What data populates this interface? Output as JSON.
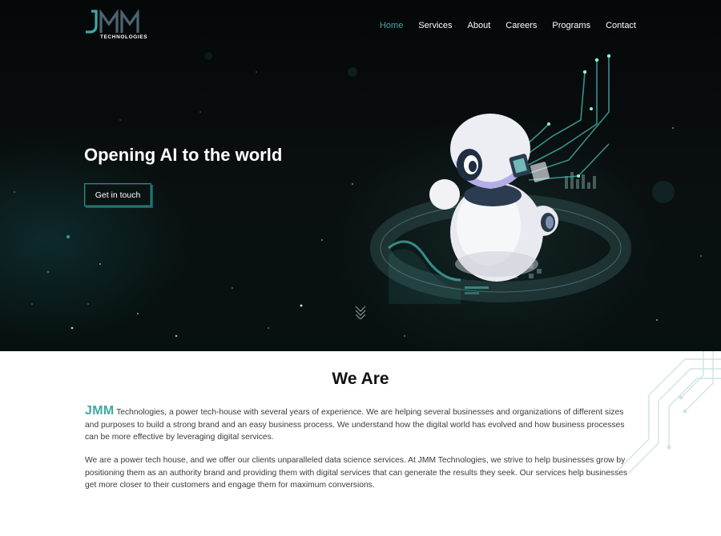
{
  "brand": {
    "logo_subtitle": "TECHNOLOGIES",
    "accent_color": "#3fa9a3"
  },
  "nav": {
    "items": [
      "Home",
      "Services",
      "About",
      "Careers",
      "Programs",
      "Contact"
    ],
    "active": "Home"
  },
  "hero": {
    "title": "Opening AI to the world",
    "cta_label": "Get in touch",
    "illustration": "robot-illustration",
    "scroll_icon": "double-chevron-down-icon"
  },
  "about": {
    "title": "We Are",
    "brand_word": "JMM",
    "paragraph1_rest": " Technologies, a power tech-house with several years of experience. We are helping several businesses and organizations of different sizes and purposes to build a strong brand and an easy business process. We understand how the digital world has evolved and how business processes can be more effective by leveraging digital services.",
    "paragraph2": "We are a power tech house, and we offer our clients unparalleled data science services. At JMM Technologies, we strive to help businesses grow by positioning them as an authority brand and providing them with digital services that can generate the results they seek. Our services help businesses get more closer to their customers and engage them for maximum conversions."
  }
}
